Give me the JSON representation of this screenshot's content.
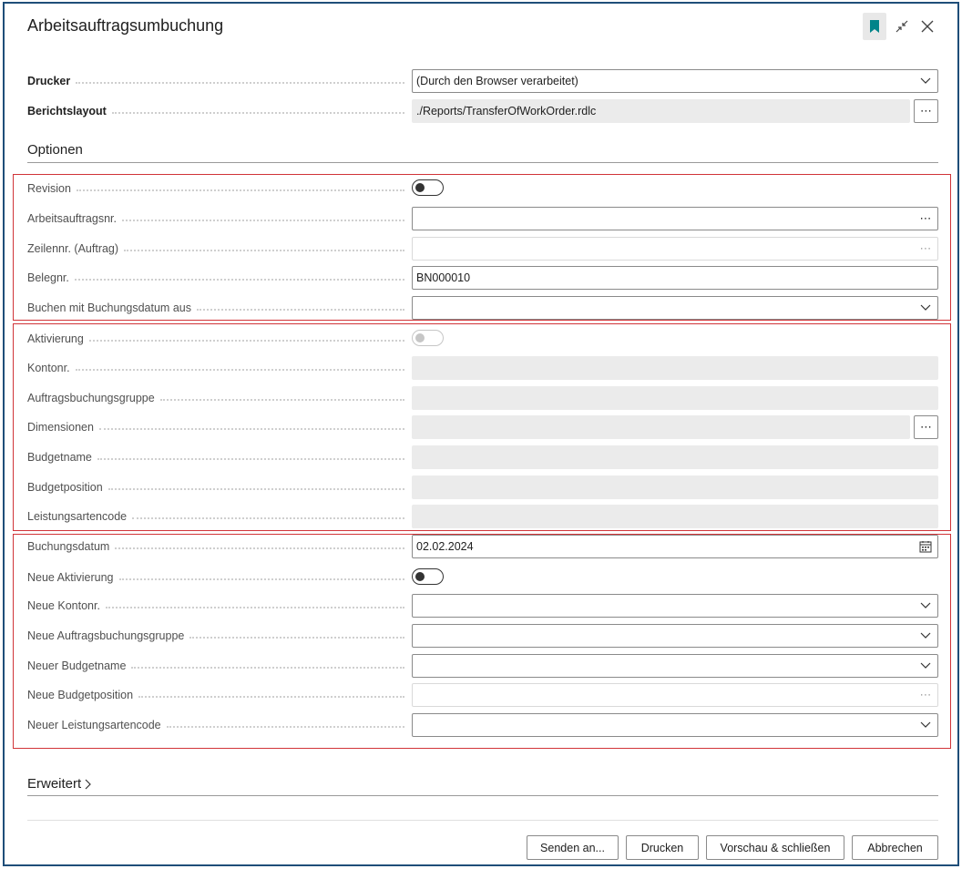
{
  "dialog": {
    "title": "Arbeitsauftragsumbuchung",
    "header_icons": [
      "bookmark-icon",
      "collapse-icon",
      "close-icon"
    ],
    "accent_color": "#008489"
  },
  "request": {
    "printer_label": "Drucker",
    "printer_value": "(Durch den Browser verarbeitet)",
    "layout_label": "Berichtslayout",
    "layout_value": "./Reports/TransferOfWorkOrder.rdlc"
  },
  "options": {
    "title": "Optionen",
    "revision_label": "Revision",
    "revision_on": false,
    "work_order_no_label": "Arbeitsauftragsnr.",
    "work_order_no_value": "",
    "line_no_label": "Zeilennr. (Auftrag)",
    "line_no_value": "",
    "document_no_label": "Belegnr.",
    "document_no_value": "BN000010",
    "post_with_date_label": "Buchen mit Buchungsdatum aus",
    "post_with_date_value": "",
    "activation_label": "Aktivierung",
    "activation_on": false,
    "account_no_label": "Kontonr.",
    "order_posting_group_label": "Auftragsbuchungsgruppe",
    "dimensions_label": "Dimensionen",
    "budget_name_label": "Budgetname",
    "budget_position_label": "Budgetposition",
    "work_type_code_label": "Leistungsartencode",
    "posting_date_label": "Buchungsdatum",
    "posting_date_value": "02.02.2024",
    "new_activation_label": "Neue Aktivierung",
    "new_activation_on": false,
    "new_account_no_label": "Neue Kontonr.",
    "new_order_posting_group_label": "Neue Auftragsbuchungsgruppe",
    "new_budget_name_label": "Neuer Budgetname",
    "new_budget_position_label": "Neue Budgetposition",
    "new_work_type_code_label": "Neuer Leistungsartencode"
  },
  "advanced": {
    "title": "Erweitert"
  },
  "footer": {
    "send_to_label": "Senden an...",
    "print_label": "Drucken",
    "preview_close_label": "Vorschau & schließen",
    "cancel_label": "Abbrechen"
  },
  "colors": {
    "highlight_border": "#d13438",
    "frame_border": "#1f4e79",
    "readonly_fill": "#ebebeb"
  }
}
